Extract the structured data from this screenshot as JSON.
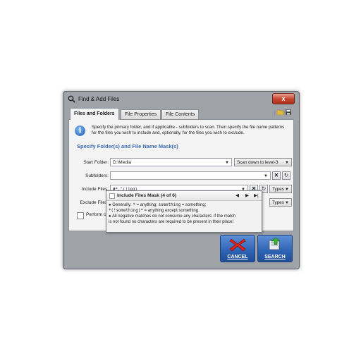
{
  "window": {
    "title": "Find & Add Files",
    "close_glyph": "x",
    "title_icon": "magnifier-icon"
  },
  "tabs": [
    {
      "label": "Files and Folders",
      "active": true
    },
    {
      "label": "File Properties",
      "active": false
    },
    {
      "label": "File Contents",
      "active": false
    }
  ],
  "toolbar": {
    "open_icon": "folder-open-icon",
    "save_icon": "save-disk-icon"
  },
  "info": {
    "text": "Specify the primary folder, and if applicable - subfolders to scan. Then specify the file name patterns for the files you wish to include and, optionally, for the files you wish to exclude."
  },
  "section_title": "Specify Folder(s) and File Name Mask(s)",
  "form": {
    "start_folder_label": "Start Folder:",
    "start_folder_value": "D:\\Media",
    "scan_depth_value": "Scan down to level-3",
    "subfolders_label": "Subfolders:",
    "subfolders_value": "",
    "include_label": "Include Files:",
    "include_value": "#*.\"(!jpg)",
    "exclude_label": "Exclude Files:",
    "exclude_value": "",
    "types_label": "Types",
    "perform_label": "Perform ca"
  },
  "tooltip": {
    "title": "Include Files Mask (4 of 6)",
    "line1_prefix": "● Generally: ",
    "line1_code1": "*",
    "line1_mid1": " = anything; ",
    "line1_code2": "something",
    "line1_mid2": " = something;",
    "line2_code": "*(!something)*",
    "line2_suffix": " = anything except something.",
    "line3": "● All negative matches do not consume any characters: if the match",
    "line4": "is not found no characters are required to be present in their place!"
  },
  "buttons": {
    "cancel_label": "CANCEL",
    "search_label": "SEARCH"
  },
  "colors": {
    "section_title": "#3a68b3",
    "button_blue": "#2d62b4",
    "cancel_x": "#d9251d",
    "close_red": "#c4432c"
  }
}
